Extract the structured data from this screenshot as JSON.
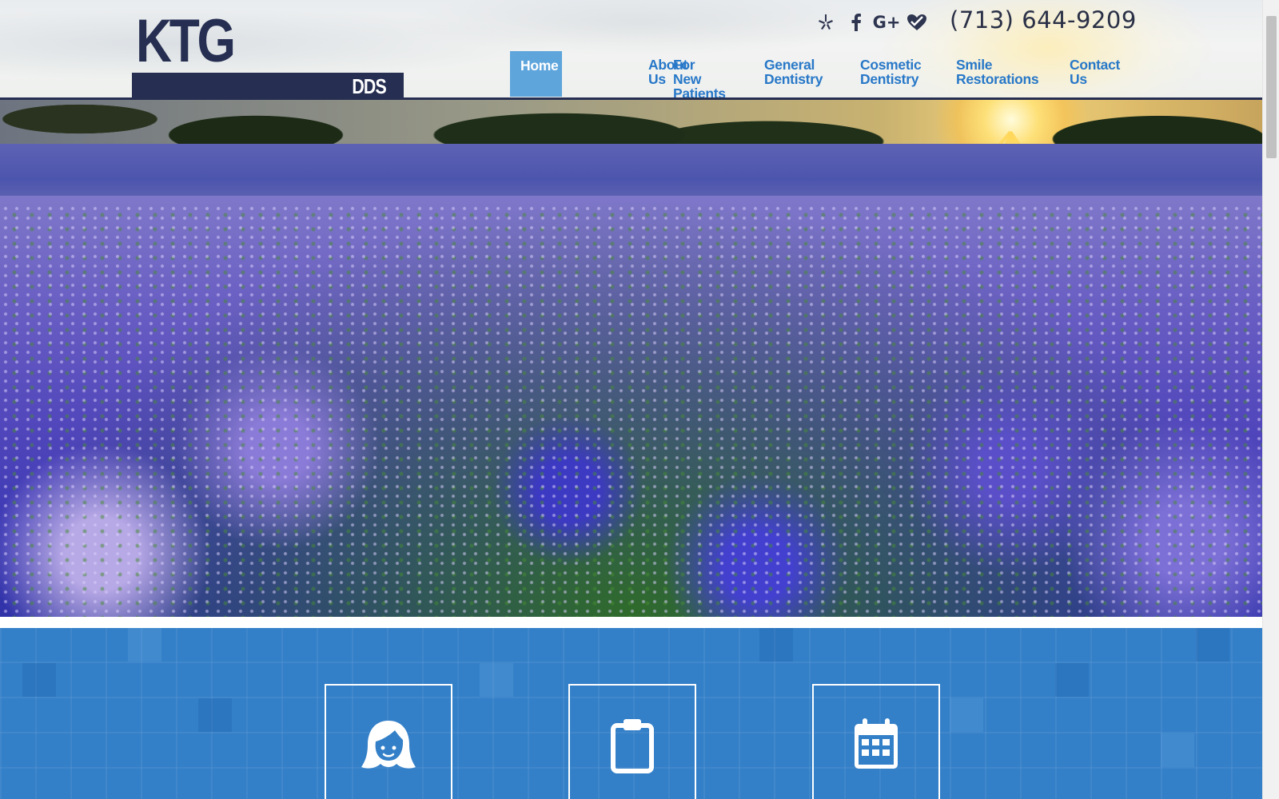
{
  "header": {
    "logo_main": "KTG",
    "logo_sub": "DDS",
    "phone": "(713) 644-9209",
    "social": [
      {
        "name": "yelp-icon"
      },
      {
        "name": "facebook-icon"
      },
      {
        "name": "google-plus-icon",
        "label": "G+"
      },
      {
        "name": "healthgrades-icon"
      }
    ]
  },
  "nav": {
    "items": [
      {
        "line1": "Home",
        "line2": "",
        "active": true
      },
      {
        "line1": "About",
        "line2": "Us",
        "active": false
      },
      {
        "line1": "For New",
        "line2": "Patients",
        "active": false
      },
      {
        "line1": "General",
        "line2": "Dentistry",
        "active": false
      },
      {
        "line1": "Cosmetic",
        "line2": "Dentistry",
        "active": false
      },
      {
        "line1": "Smile",
        "line2": "Restorations",
        "active": false
      },
      {
        "line1": "Contact",
        "line2": "Us",
        "active": false
      }
    ]
  },
  "cards": [
    {
      "icon": "patient-woman-icon"
    },
    {
      "icon": "clipboard-icon"
    },
    {
      "icon": "calendar-icon"
    }
  ],
  "colors": {
    "brand_navy": "#262f52",
    "nav_link": "#2878c8",
    "nav_active_bg": "#5ea5dc",
    "band_blue": "#3480c8"
  }
}
